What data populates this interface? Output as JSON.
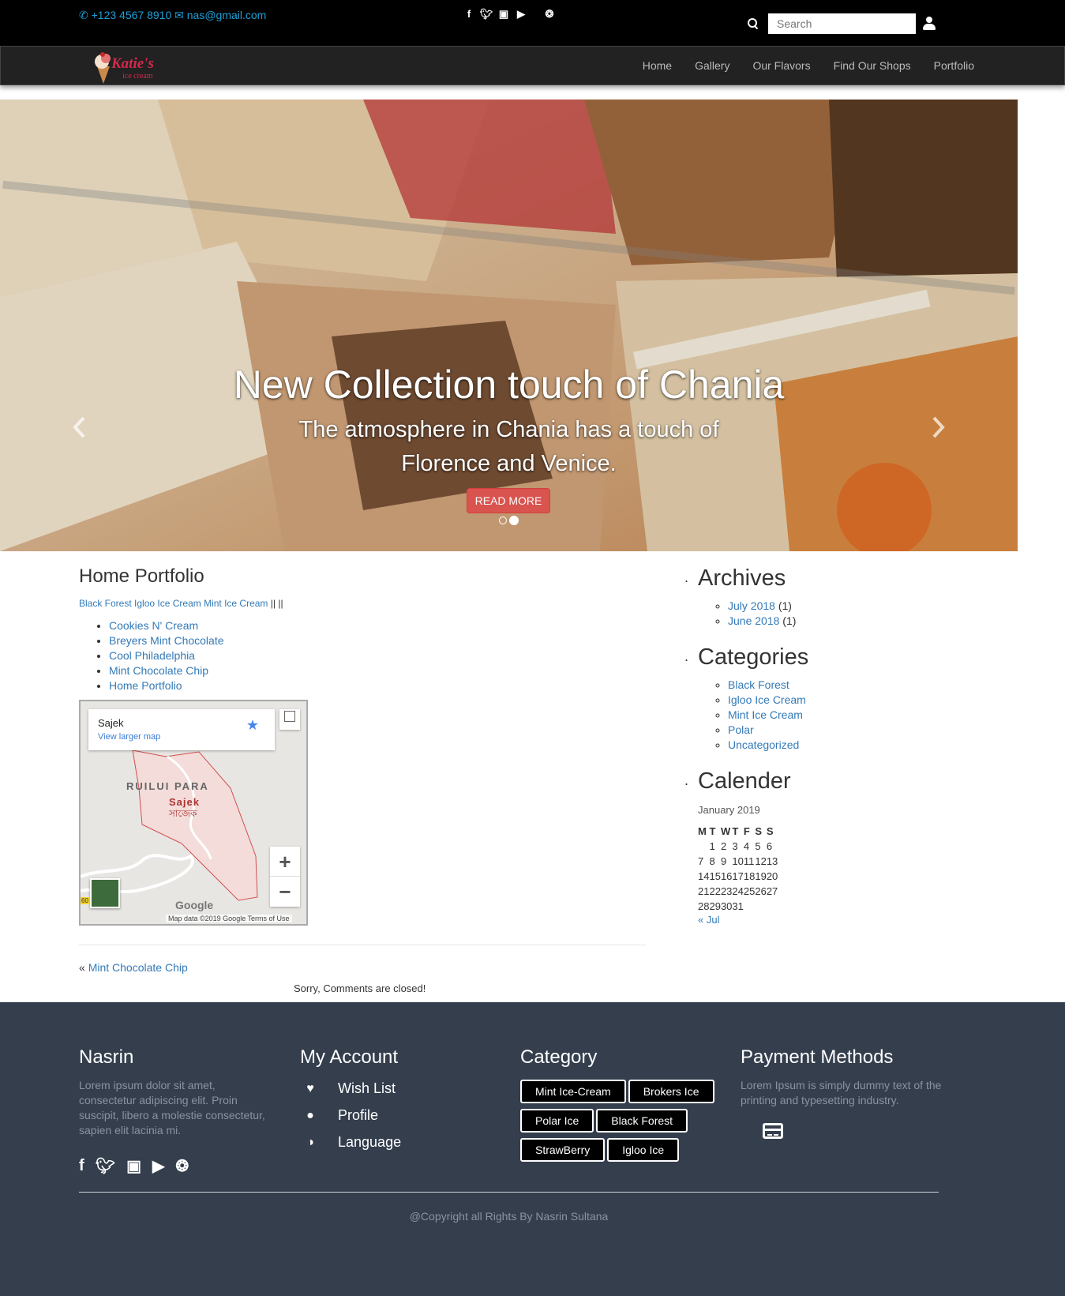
{
  "topbar": {
    "phone": "+123 4567 8910",
    "email": "nas@gmail.com",
    "social": [
      "facebook-icon",
      "twitter-icon",
      "instagram-icon",
      "youtube-icon",
      "dribbble-icon"
    ],
    "search_placeholder": "Search"
  },
  "nav": {
    "logo_text": "Katie's",
    "logo_sub": "ice cream",
    "items": [
      "Home",
      "Gallery",
      "Our Flavors",
      "Find Our Shops",
      "Portfolio"
    ]
  },
  "hero": {
    "title": "New Collection touch of Chania",
    "subtitle": "The atmosphere in Chania has a touch of Florence and Venice.",
    "button": "READ MORE",
    "active_slide": 2,
    "slide_count": 2
  },
  "main": {
    "title": "Home Portfolio",
    "category_links": [
      "Black Forest",
      "Igloo Ice Cream",
      "Mint Ice Cream"
    ],
    "category_suffix": "|| ||",
    "posts": [
      "Cookies N' Cream",
      "Breyers Mint Chocolate",
      "Cool Philadelphia",
      "Mint Chocolate Chip",
      "Home Portfolio"
    ],
    "map": {
      "place": "Sajek",
      "larger_map": "View larger map",
      "area_label": "RUILUI PARA",
      "pin_label": "Sajek",
      "pin_label_bn": "সাজেক",
      "road_badge": "60",
      "brand": "Google",
      "footer": "Map data ©2019 Google    Terms of Use"
    },
    "prev_arrow": "«",
    "prev_post": "Mint Chocolate Chip",
    "comments_closed": "Sorry, Comments are closed!"
  },
  "sidebar": {
    "archives_title": "Archives",
    "archives": [
      {
        "label": "July 2018",
        "count": "(1)"
      },
      {
        "label": "June 2018",
        "count": "(1)"
      }
    ],
    "categories_title": "Categories",
    "categories": [
      "Black Forest",
      "Igloo Ice Cream",
      "Mint Ice Cream",
      "Polar",
      "Uncategorized"
    ],
    "calendar_title": "Calender",
    "calendar": {
      "caption": "January 2019",
      "headers": [
        "M",
        "T",
        "W",
        "T",
        "F",
        "S",
        "S"
      ],
      "rows": [
        [
          "",
          "1",
          "2",
          "3",
          "4",
          "5",
          "6"
        ],
        [
          "7",
          "8",
          "9",
          "10",
          "11",
          "12",
          "13"
        ],
        [
          "14",
          "15",
          "16",
          "17",
          "18",
          "19",
          "20"
        ],
        [
          "21",
          "22",
          "23",
          "24",
          "25",
          "26",
          "27"
        ],
        [
          "28",
          "29",
          "30",
          "31",
          "",
          "",
          ""
        ]
      ],
      "prev": "« Jul"
    }
  },
  "footer": {
    "col1_title": "Nasrin",
    "col1_text": "Lorem ipsum dolor sit amet, consectetur adipiscing elit. Proin suscipit, libero a molestie consectetur, sapien elit lacinia mi.",
    "col2_title": "My Account",
    "account": [
      {
        "icon": "heart-icon",
        "label": "Wish List"
      },
      {
        "icon": "user-icon",
        "label": "Profile"
      },
      {
        "icon": "globe-icon",
        "label": "Language"
      }
    ],
    "col3_title": "Category",
    "tags": [
      "Mint Ice-Cream",
      "Brokers Ice",
      "Polar Ice",
      "Black Forest",
      "StrawBerry",
      "Igloo Ice"
    ],
    "col4_title": "Payment Methods",
    "col4_text": "Lorem Ipsum is simply dummy text of the printing and typesetting industry.",
    "copyright": "@Copyright all Rights By Nasrin Sultana"
  },
  "colors": {
    "topbar_bg": "#000000",
    "contact": "#1e9fd6",
    "link": "#337ab7",
    "read_more": "#d9534f",
    "footer_bg": "#343e4d"
  }
}
